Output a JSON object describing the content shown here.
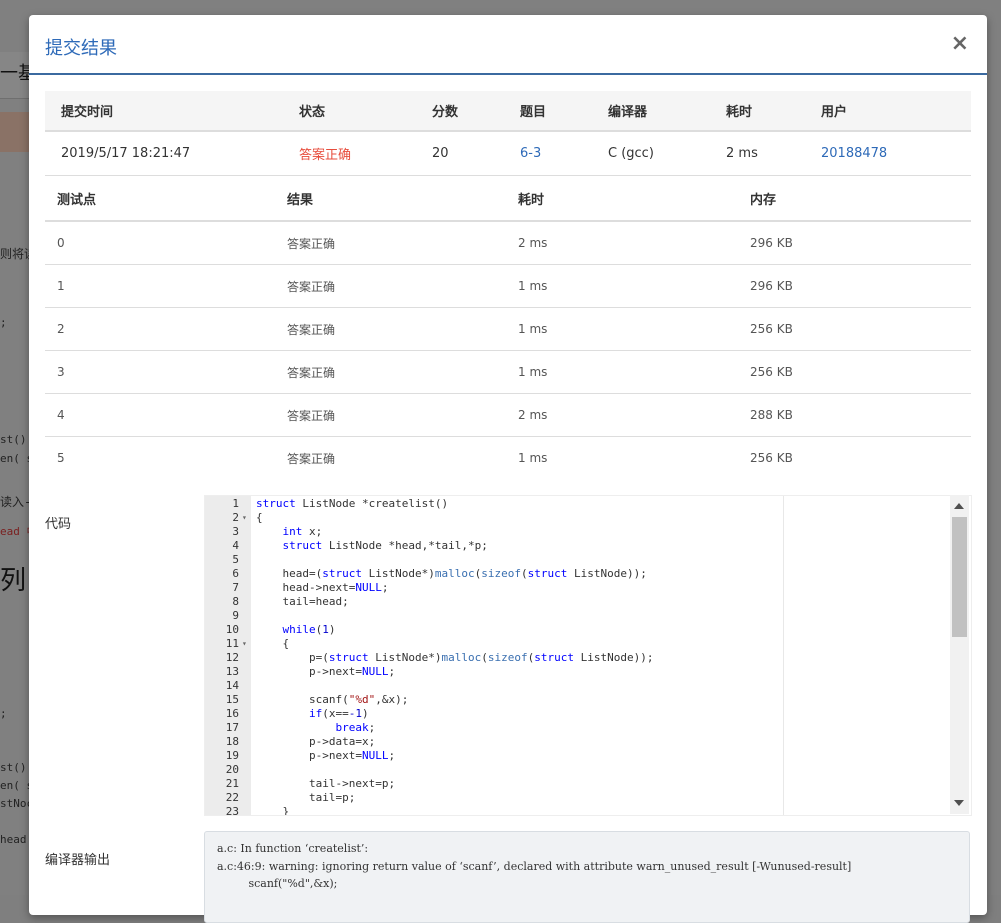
{
  "modal": {
    "title": "提交结果",
    "close": "×"
  },
  "summary": {
    "headers": [
      "提交时间",
      "状态",
      "分数",
      "题目",
      "编译器",
      "耗时",
      "用户"
    ],
    "row": {
      "time": "2019/5/17 18:21:47",
      "status": "答案正确",
      "score": "20",
      "problem": "6-3",
      "compiler": "C (gcc)",
      "elapsed": "2 ms",
      "user": "20188478"
    }
  },
  "cases": {
    "headers": [
      "测试点",
      "结果",
      "耗时",
      "内存"
    ],
    "rows": [
      {
        "id": "0",
        "result": "答案正确",
        "time": "2 ms",
        "mem": "296 KB"
      },
      {
        "id": "1",
        "result": "答案正确",
        "time": "1 ms",
        "mem": "296 KB"
      },
      {
        "id": "2",
        "result": "答案正确",
        "time": "1 ms",
        "mem": "256 KB"
      },
      {
        "id": "3",
        "result": "答案正确",
        "time": "1 ms",
        "mem": "256 KB"
      },
      {
        "id": "4",
        "result": "答案正确",
        "time": "2 ms",
        "mem": "288 KB"
      },
      {
        "id": "5",
        "result": "答案正确",
        "time": "1 ms",
        "mem": "256 KB"
      }
    ]
  },
  "code_label": "代码",
  "compiler_label": "编译器输出",
  "code_lines": [
    "struct ListNode *createlist()",
    "{",
    "    int x;",
    "    struct ListNode *head,*tail,*p;",
    "",
    "    head=(struct ListNode*)malloc(sizeof(struct ListNode));",
    "    head->next=NULL;",
    "    tail=head;",
    "",
    "    while(1)",
    "    {",
    "        p=(struct ListNode*)malloc(sizeof(struct ListNode));",
    "        p->next=NULL;",
    "",
    "        scanf(\"%d\",&x);",
    "        if(x==-1)",
    "            break;",
    "        p->data=x;",
    "        p->next=NULL;",
    "",
    "        tail->next=p;",
    "        tail=p;",
    "    }"
  ],
  "compiler_output": [
    "a.c: In function ‘createlist’:",
    "a.c:46:9: warning: ignoring return value of ‘scanf’, declared with attribute warn_unused_result [-Wunused-result]",
    "         scanf(\"%d\",&x);"
  ],
  "background_fragments": [
    "一基",
    "则将读",
    ";",
    "st()",
    "en( s",
    "读入-",
    "ead 中",
    "列:",
    ";",
    "st()",
    "en( s",
    "stNoc",
    "head"
  ],
  "colors": {
    "accent": "#2e6ab8",
    "ok": "#e74c3c"
  }
}
